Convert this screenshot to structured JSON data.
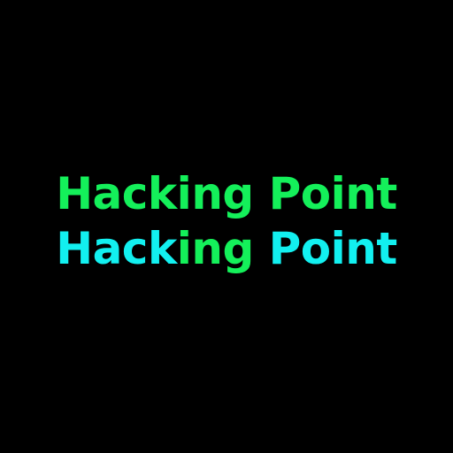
{
  "logo": {
    "line1": {
      "segments": [
        {
          "text": "Hacking",
          "color": "#14f05a"
        },
        {
          "text": " ",
          "color": "#14f05a"
        },
        {
          "text": "Point",
          "color": "#14f05a"
        }
      ]
    },
    "line2": {
      "segments": [
        {
          "text": "Hack",
          "color": "#12f0f0"
        },
        {
          "text": "ing",
          "color": "#14f05a"
        },
        {
          "text": " Point",
          "color": "#12f0f0"
        }
      ]
    }
  },
  "colors": {
    "background": "#000000",
    "green": "#14f05a",
    "cyan": "#12f0f0"
  }
}
